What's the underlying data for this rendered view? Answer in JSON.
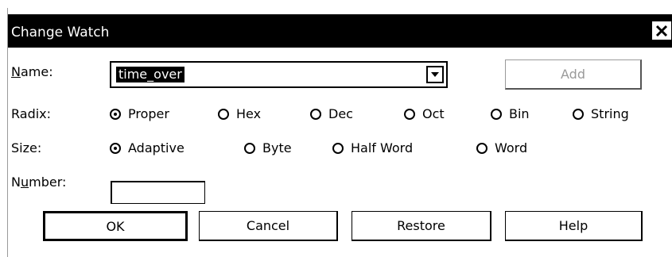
{
  "window": {
    "title": "Change Watch"
  },
  "name_row": {
    "label": "Name:",
    "value": "time_over",
    "add_label": "Add"
  },
  "radix": {
    "label": "Radix:",
    "options": [
      "Proper",
      "Hex",
      "Dec",
      "Oct",
      "Bin",
      "String"
    ],
    "selected": "Proper"
  },
  "size": {
    "label": "Size:",
    "options": [
      "Adaptive",
      "Byte",
      "Half Word",
      "Word"
    ],
    "selected": "Adaptive"
  },
  "number": {
    "label": "Number:",
    "value": ""
  },
  "buttons": {
    "ok": "OK",
    "cancel": "Cancel",
    "restore": "Restore",
    "help": "Help"
  },
  "icons": {
    "close": "close-icon",
    "dropdown": "chevron-down-icon"
  }
}
